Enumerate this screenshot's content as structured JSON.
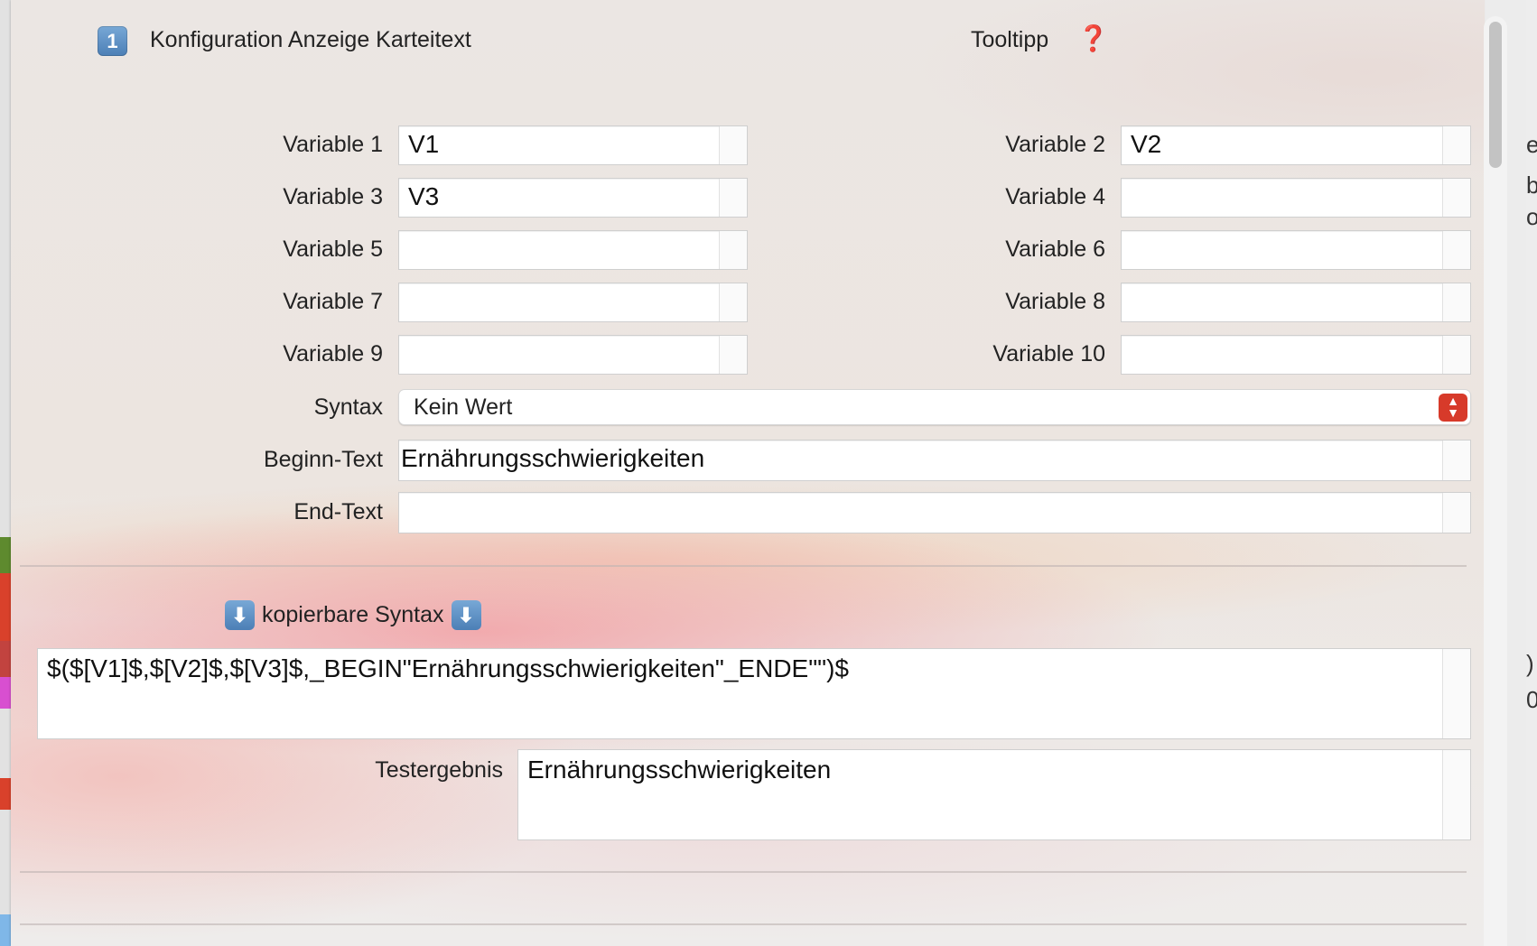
{
  "header": {
    "badge": "1",
    "title": "Konfiguration Anzeige Karteitext",
    "tooltip_label": "Tooltipp",
    "tooltip_icon": "❓"
  },
  "variables": [
    {
      "label": "Variable 1",
      "value": "V1"
    },
    {
      "label": "Variable 2",
      "value": "V2"
    },
    {
      "label": "Variable 3",
      "value": "V3"
    },
    {
      "label": "Variable 4",
      "value": ""
    },
    {
      "label": "Variable 5",
      "value": ""
    },
    {
      "label": "Variable 6",
      "value": ""
    },
    {
      "label": "Variable 7",
      "value": ""
    },
    {
      "label": "Variable 8",
      "value": ""
    },
    {
      "label": "Variable 9",
      "value": ""
    },
    {
      "label": "Variable 10",
      "value": ""
    }
  ],
  "syntax": {
    "label": "Syntax",
    "value": "Kein Wert"
  },
  "begin_text": {
    "label": "Beginn-Text",
    "value": "Ernährungsschwierigkeiten"
  },
  "end_text": {
    "label": "End-Text",
    "value": ""
  },
  "copyable": {
    "label": "kopierbare Syntax",
    "arrow_icon": "⬇",
    "value": "$($[V1]$,$[V2]$,$[V3]$,_BEGIN\"Ernährungsschwierigkeiten\"_ENDE\"\")$"
  },
  "test_result": {
    "label": "Testergebnis",
    "value": "Ernährungsschwierigkeiten"
  },
  "colors": {
    "accent_red": "#d73a2a",
    "badge_blue": "#5a8cc2"
  }
}
